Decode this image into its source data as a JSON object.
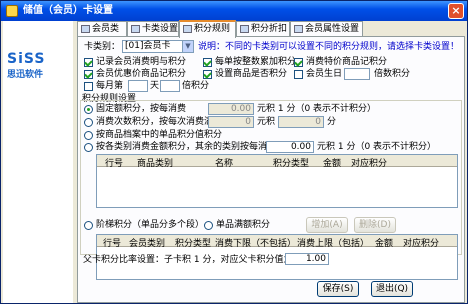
{
  "window": {
    "title": "储值（会员）卡设置"
  },
  "brand": {
    "logo_text": "SiSS",
    "logo_sub": "思迅软件"
  },
  "tabs": [
    "会员类别",
    "卡类设置",
    "积分规则",
    "积分折扣",
    "会员属性设置"
  ],
  "active_tab": "积分规则",
  "card_type": {
    "label": "卡类别：",
    "value": "[01]会员卡",
    "note": "说明：不同的卡类别可以设置不同的积分规则，请选择卡类设置！"
  },
  "options": {
    "row1": [
      {
        "label": "记录会员消费明与积分",
        "checked": true
      },
      {
        "label": "每单按整数累加积分",
        "checked": true
      },
      {
        "label": "消费特价商品记积分",
        "checked": true
      }
    ],
    "row2": [
      {
        "label": "会员优惠价商品记积分",
        "checked": true
      },
      {
        "label": "设置商品是否积分",
        "checked": true
      },
      {
        "label": "会员生日",
        "checked": false
      },
      {
        "suffix": "倍数积分"
      }
    ],
    "row3": {
      "label": "每月第",
      "mid": "天",
      "suffix": "倍积分",
      "checked": false
    }
  },
  "rules": {
    "title": "积分规则设置",
    "fixed": {
      "label": "固定额积分，按每消费",
      "value": "0.00",
      "suffix": "元积 1 分（0 表示不计积分）"
    },
    "per_count": {
      "label": "消费次数积分，按每次消费满",
      "value": "0",
      "unit": "元积",
      "value2": "0",
      "suffix": "分"
    },
    "by_goods": {
      "label": "按商品档案中的单品积分值积分"
    },
    "by_category": {
      "label": "按各类别消费金额积分，其余的类别按每消费",
      "value": "0.00",
      "suffix": "元积 1 分（0 表示不计积分）"
    },
    "grid1_headers": [
      "行号",
      "商品类别",
      "名称",
      "积分类型",
      "金额",
      "对应积分"
    ],
    "ladder": {
      "label": "阶梯积分（单品分多个段）"
    },
    "single": {
      "label": "单品满额积分"
    },
    "add_btn": "增加(A)",
    "del_btn": "删除(D)",
    "grid2_headers": [
      "行号",
      "会员类别",
      "积分类型",
      "消费下限（不包括）",
      "消费上限（包括）",
      "金额",
      "对应积分"
    ]
  },
  "ratio": {
    "label": "父卡积分比率设置：子卡积 1 分，对应父卡积分值为：",
    "value": "1.00"
  },
  "buttons": {
    "save": "保存(S)",
    "exit": "退出(Q)"
  }
}
